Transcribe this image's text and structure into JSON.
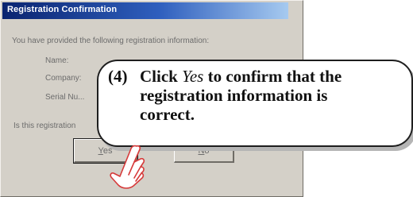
{
  "window": {
    "title": "Registration Confirmation",
    "prompt": "You have provided the following registration information:",
    "fields": {
      "name_label": "Name:",
      "company_label": "Company:",
      "serial_label": "Serial Nu..."
    },
    "question": "Is this registration"
  },
  "buttons": {
    "yes": {
      "label": "Yes",
      "underline_char": "Y",
      "rest": "es"
    },
    "no": {
      "label": "No",
      "underline_char": "N",
      "rest": "o"
    }
  },
  "callout": {
    "step": "(4)",
    "text_before": "Click ",
    "emphasis": "Yes",
    "text_after": " to confirm that the",
    "line2": "registration information is",
    "line3": "correct."
  },
  "icons": {
    "pointer": "hand-pointer-icon"
  },
  "colors": {
    "titlebar_start": "#0a2470",
    "titlebar_end": "#a6caf0",
    "dialog_bg": "#d4d0c8",
    "hand_stroke": "#d63a3a"
  }
}
